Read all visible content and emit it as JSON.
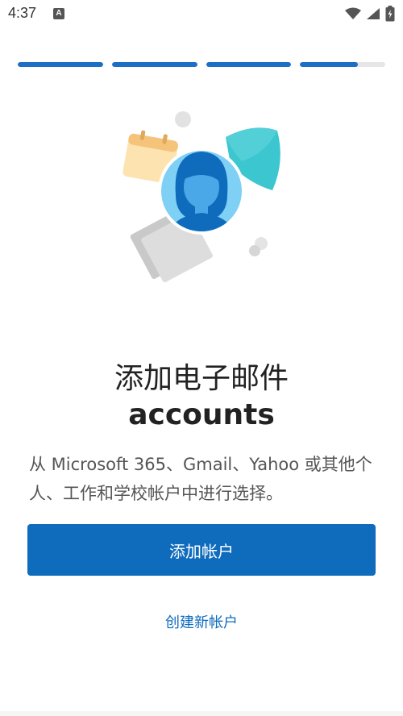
{
  "status_bar": {
    "time": "4:37",
    "notification_icon": "A",
    "icons": [
      "wifi-icon",
      "signal-icon",
      "battery-icon"
    ]
  },
  "progress": {
    "segments": [
      1.0,
      1.0,
      1.0,
      0.68
    ],
    "accent_color": "#1c6fc4"
  },
  "illustration": {
    "icon": "person-avatar-illustration"
  },
  "content": {
    "title_line1": "添加电子邮件",
    "title_line2": "accounts",
    "description": "从 Microsoft 365、Gmail、Yahoo 或其他个人、工作和学校帐户中进行选择。"
  },
  "actions": {
    "primary_label": "添加帐户",
    "secondary_label": "创建新帐户"
  },
  "colors": {
    "primary": "#0f6cbd",
    "avatar_bg": "#7fd0f5",
    "shield": "#3cc6cf",
    "calendar": "#f5c47a"
  }
}
